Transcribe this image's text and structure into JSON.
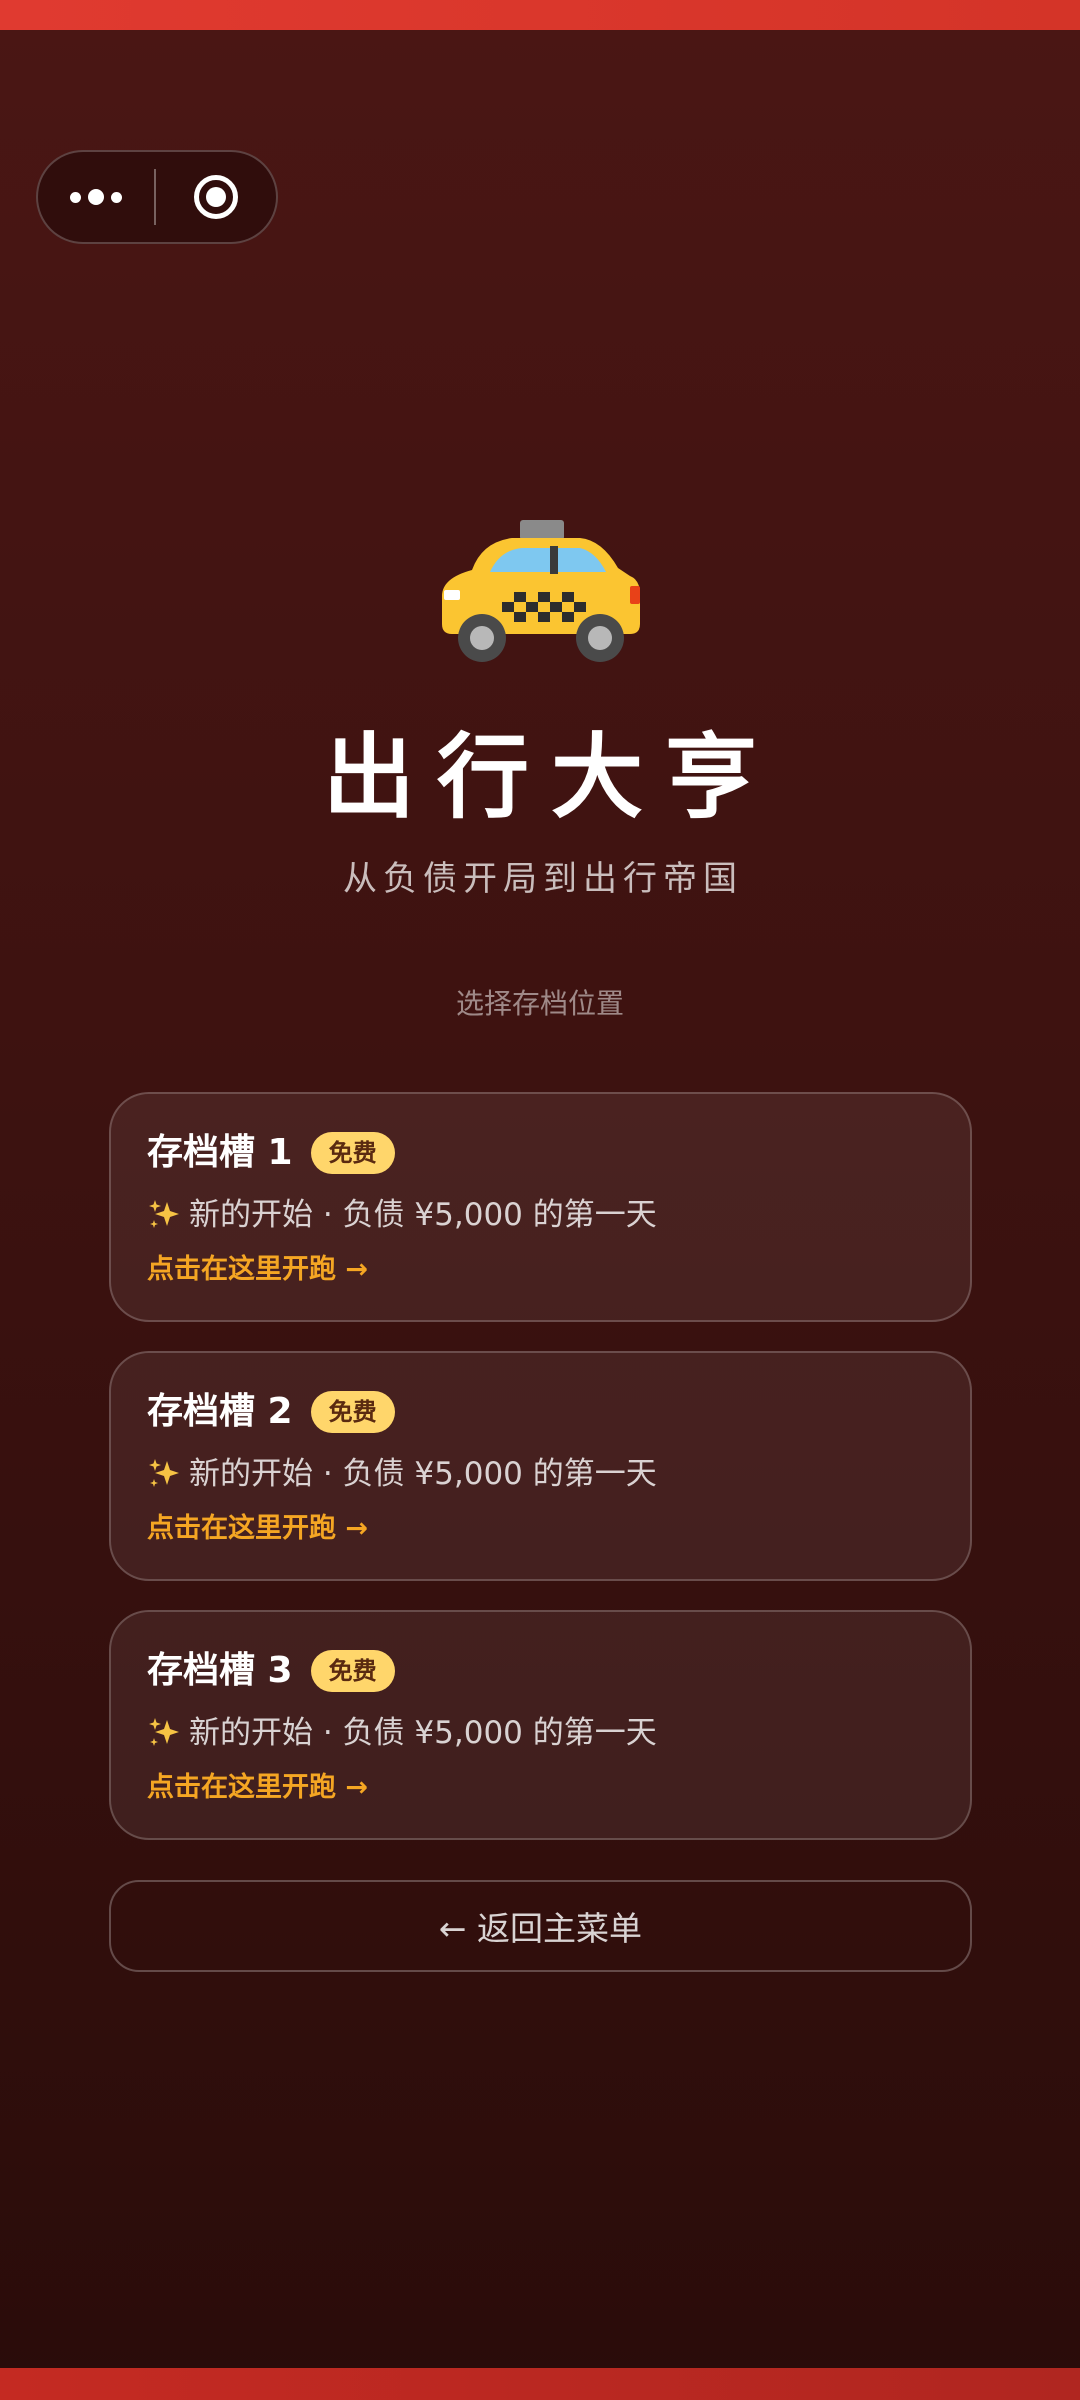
{
  "app": {
    "title": "出行大亨",
    "subtitle": "从负债开局到出行帝国",
    "icon": "taxi-icon"
  },
  "capsule": {
    "more_icon": "more-dots-icon",
    "close_icon": "target-icon"
  },
  "section_label": "选择存档位置",
  "slots": [
    {
      "title": "存档槽 1",
      "badge": "免费",
      "desc": "新的开始 · 负债 ¥5,000 的第一天",
      "action": "点击在这里开跑 →"
    },
    {
      "title": "存档槽 2",
      "badge": "免费",
      "desc": "新的开始 · 负债 ¥5,000 的第一天",
      "action": "点击在这里开跑 →"
    },
    {
      "title": "存档槽 3",
      "badge": "免费",
      "desc": "新的开始 · 负债 ¥5,000 的第一天",
      "action": "点击在这里开跑 →"
    }
  ],
  "back_button": "← 返回主菜单",
  "colors": {
    "accent_orange": "#f5a623",
    "badge_yellow": "#ffd66b",
    "top_bar_red": "#e03a30",
    "background_dark_red": "#3d1210"
  }
}
